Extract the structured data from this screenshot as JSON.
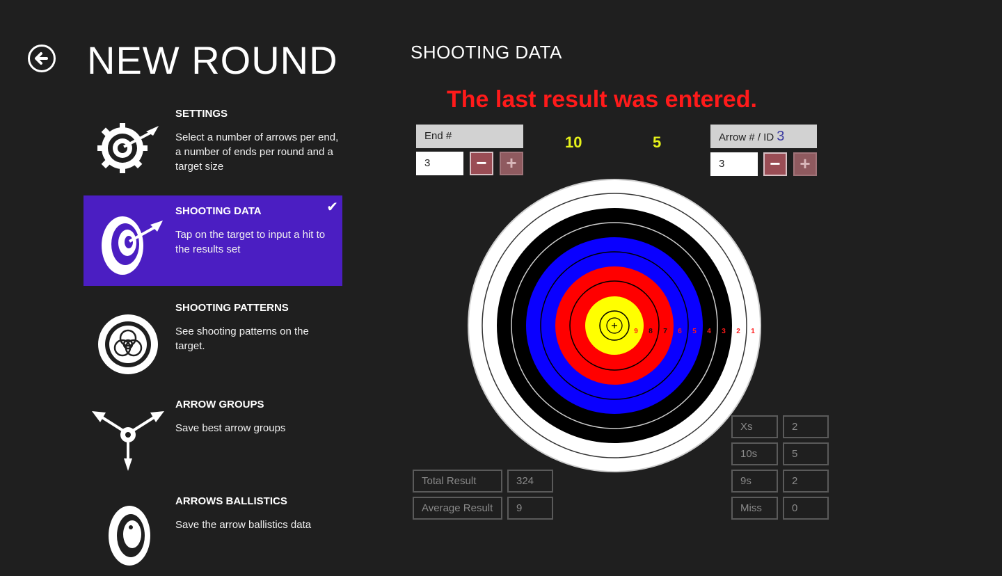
{
  "header": {
    "page_title": "NEW ROUND",
    "section_title": "SHOOTING DATA"
  },
  "nav": {
    "items": [
      {
        "title": "SETTINGS",
        "desc": "Select a number of arrows per end, a number of ends per round and a target size",
        "icon": "gear-target-icon",
        "selected": false
      },
      {
        "title": "SHOOTING DATA",
        "desc": "Tap on the target to input a hit to the results set",
        "icon": "target-arrow-icon",
        "selected": true
      },
      {
        "title": "SHOOTING PATTERNS",
        "desc": "See shooting patterns on the target.",
        "icon": "pattern-target-icon",
        "selected": false
      },
      {
        "title": "ARROW GROUPS",
        "desc": "Save best arrow groups",
        "icon": "arrow-group-icon",
        "selected": false
      },
      {
        "title": "ARROWS BALLISTICS",
        "desc": "Save the arrow ballistics data",
        "icon": "ballistics-target-icon",
        "selected": false
      }
    ]
  },
  "shooting": {
    "status_message": "The last result was entered.",
    "end_label": "End #",
    "end_value": "3",
    "arrow_label": "Arrow # / ID",
    "arrow_id": "3",
    "arrow_value": "3",
    "score_1": "10",
    "score_2": "5",
    "minus_symbol": "−",
    "plus_symbol": "+",
    "ring_labels": [
      "9",
      "8",
      "7",
      "6",
      "5",
      "4",
      "3",
      "2",
      "1"
    ],
    "stats_left": [
      {
        "label": "Total Result",
        "value": "324"
      },
      {
        "label": "Average Result",
        "value": "9"
      }
    ],
    "stats_right": [
      {
        "label": "Xs",
        "value": "2"
      },
      {
        "label": "10s",
        "value": "5"
      },
      {
        "label": "9s",
        "value": "2"
      },
      {
        "label": "Miss",
        "value": "0"
      }
    ]
  },
  "colors": {
    "background": "#1f1f1f",
    "selected": "#4b1ec2",
    "status": "#ff1a1a",
    "score": "#e6f21a",
    "ring_label_red": "#ff1a1a",
    "ring_label_dark": "#111111"
  }
}
